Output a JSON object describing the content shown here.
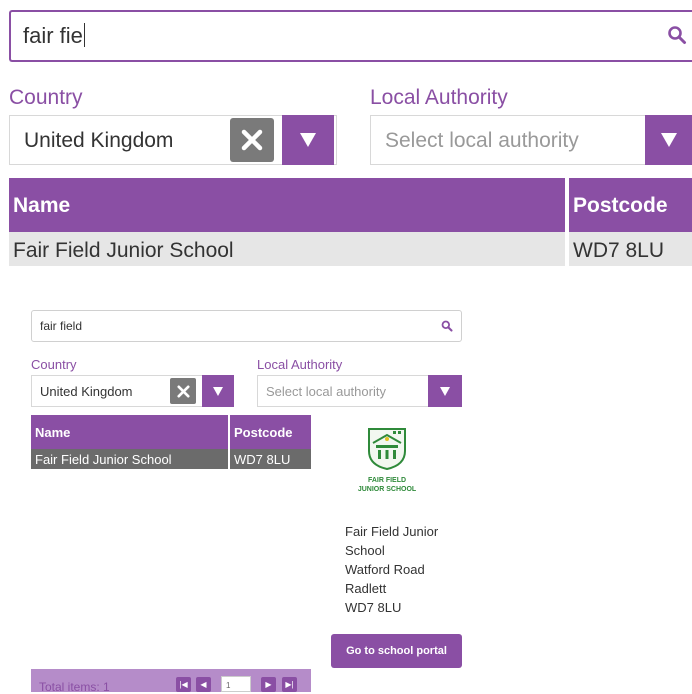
{
  "zoomed": {
    "search_value": "fair fie",
    "country_label": "Country",
    "country_value": "United Kingdom",
    "authority_label": "Local Authority",
    "authority_placeholder": "Select local authority",
    "col_name": "Name",
    "col_postcode": "Postcode",
    "row_name": "Fair Field Junior School",
    "row_postcode": "WD7 8LU"
  },
  "finder": {
    "search_value": "fair field",
    "country_label": "Country",
    "country_value": "United Kingdom",
    "authority_label": "Local Authority",
    "authority_placeholder": "Select local authority",
    "col_name": "Name",
    "col_postcode": "Postcode",
    "row_name": "Fair Field Junior School",
    "row_postcode": "WD7 8LU"
  },
  "school": {
    "logo_line1": "FAIR FIELD",
    "logo_line2": "JUNIOR SCHOOL",
    "address": [
      "Fair Field Junior",
      "School",
      "Watford Road",
      "Radlett",
      "WD7 8LU"
    ],
    "portal_button": "Go to school portal"
  },
  "pager": {
    "total_label": "Total items: 1",
    "page": "1"
  },
  "colors": {
    "accent": "#8a4fa4",
    "selected_row": "#6b6b6b",
    "pager_bg": "#b58cc9"
  }
}
